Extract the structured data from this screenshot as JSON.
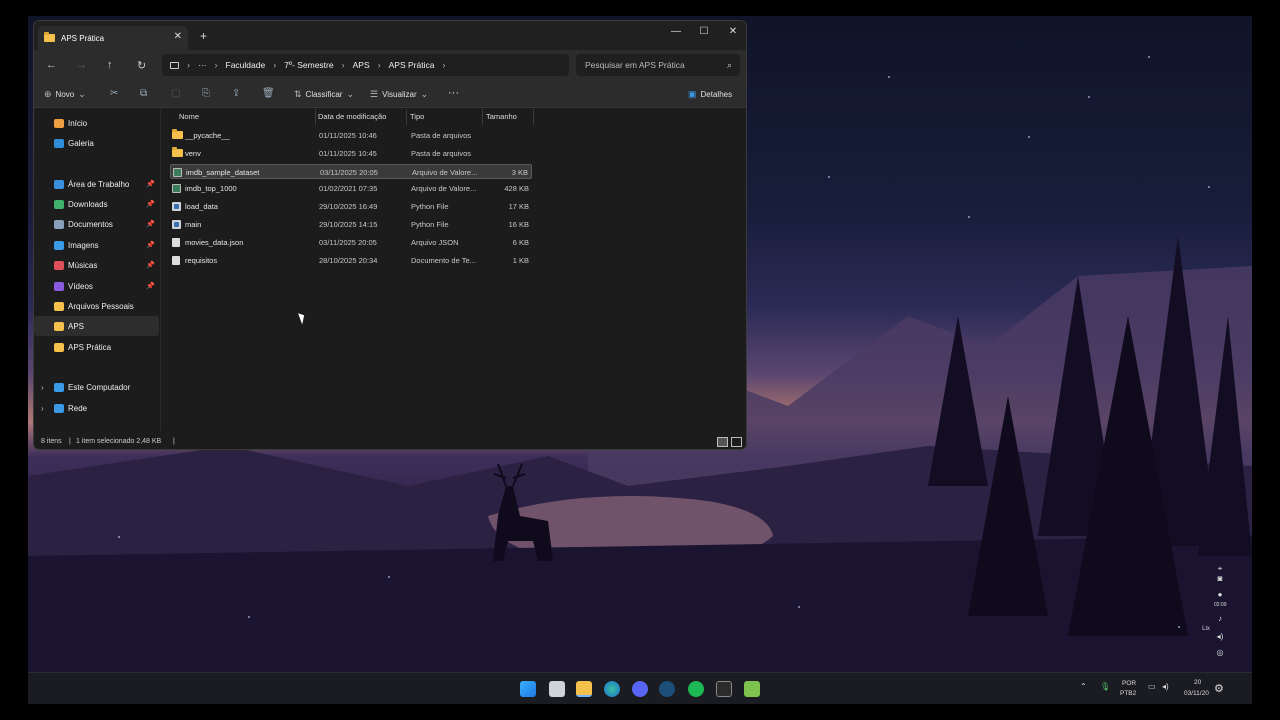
{
  "window": {
    "tab_title": "APS Prática",
    "tab_close": "✕",
    "new_tab": "+",
    "controls": {
      "minimize": "—",
      "maximize": "☐",
      "close": "✕"
    }
  },
  "address_bar": {
    "nav": {
      "back": "←",
      "forward": "→",
      "up": "↑",
      "refresh": "↻"
    },
    "more": "···",
    "breadcrumb": [
      "Faculdade",
      "7º- Semestre",
      "APS",
      "APS Prática"
    ],
    "separator": "›",
    "search_placeholder": "Pesquisar em APS Prática"
  },
  "toolbar": {
    "new_label": "Novo",
    "sort_label": "Classificar",
    "view_label": "Visualizar",
    "more": "···",
    "details_label": "Detalhes"
  },
  "sidebar": {
    "items": [
      {
        "label": "Início",
        "icon": "home-icon",
        "color": "#f0a040",
        "pinned": false
      },
      {
        "label": "Galeria",
        "icon": "gallery-icon",
        "color": "#2f8fd8",
        "pinned": false
      },
      {
        "label": "Área de Trabalho",
        "icon": "desktop-icon",
        "color": "#3a8fe0",
        "pinned": true
      },
      {
        "label": "Downloads",
        "icon": "download-icon",
        "color": "#3fb36b",
        "pinned": true
      },
      {
        "label": "Documentos",
        "icon": "documents-icon",
        "color": "#8aa0b8",
        "pinned": true
      },
      {
        "label": "Imagens",
        "icon": "images-icon",
        "color": "#3a9ae8",
        "pinned": true
      },
      {
        "label": "Músicas",
        "icon": "music-icon",
        "color": "#e0505a",
        "pinned": true
      },
      {
        "label": "Vídeos",
        "icon": "videos-icon",
        "color": "#8a5ae0",
        "pinned": true
      },
      {
        "label": "Arquivos Pessoais",
        "icon": "folder-icon",
        "color": "#f5c04b",
        "pinned": false
      },
      {
        "label": "APS",
        "icon": "folder-icon",
        "color": "#f5c04b",
        "pinned": false
      },
      {
        "label": "APS Prática",
        "icon": "folder-icon",
        "color": "#f5c04b",
        "pinned": false
      },
      {
        "label": "Este Computador",
        "icon": "computer-icon",
        "color": "#3a9ae8",
        "pinned": false
      },
      {
        "label": "Rede",
        "icon": "network-icon",
        "color": "#3a9ae8",
        "pinned": false
      }
    ]
  },
  "columns": [
    "Nome",
    "Data de modificação",
    "Tipo",
    "Tamanho"
  ],
  "files": [
    {
      "name": "__pycache__",
      "date": "01/11/2025 10:46",
      "type": "Pasta de arquivos",
      "size": "",
      "icon": "folder"
    },
    {
      "name": "venv",
      "date": "01/11/2025 10:45",
      "type": "Pasta de arquivos",
      "size": "",
      "icon": "folder"
    },
    {
      "name": "imdb_sample_dataset",
      "date": "03/11/2025 20:05",
      "type": "Arquivo de Valore...",
      "size": "3 KB",
      "icon": "csv"
    },
    {
      "name": "imdb_top_1000",
      "date": "01/02/2021 07:35",
      "type": "Arquivo de Valore...",
      "size": "428 KB",
      "icon": "csv"
    },
    {
      "name": "load_data",
      "date": "29/10/2025 16:49",
      "type": "Python File",
      "size": "17 KB",
      "icon": "python"
    },
    {
      "name": "main",
      "date": "29/10/2025 14:15",
      "type": "Python File",
      "size": "16 KB",
      "icon": "python"
    },
    {
      "name": "movies_data.json",
      "date": "03/11/2025 20:05",
      "type": "Arquivo JSON",
      "size": "6 KB",
      "icon": "doc"
    },
    {
      "name": "requisitos",
      "date": "28/10/2025 20:34",
      "type": "Documento de Te...",
      "size": "1 KB",
      "icon": "doc"
    }
  ],
  "status": {
    "count": "8 itens",
    "selected": "1 item selecionado  2,48 KB"
  },
  "taskbar": {
    "lang_top": "POR",
    "lang_bottom": "PTB2",
    "clock_top": "20",
    "clock_bottom": "03/11/20"
  },
  "widget": {
    "time": "02:09",
    "label": "Lix"
  },
  "colors": {
    "accent": "#3a9ae8",
    "folder": "#f5c04b",
    "window_bg": "#1c1c1c"
  }
}
